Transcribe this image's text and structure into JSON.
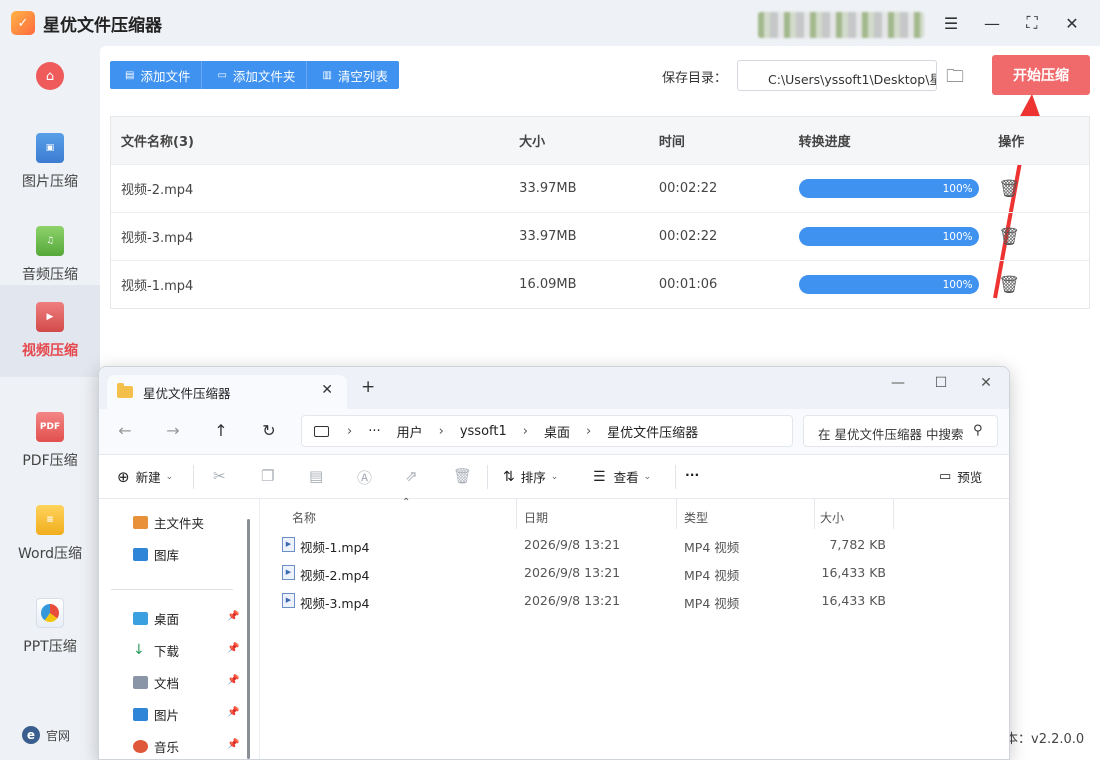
{
  "app": {
    "title": "星优文件压缩器",
    "version": "本：v2.2.0.0"
  },
  "titlebar": {
    "icons": [
      "settings-icon",
      "minimize-icon",
      "maximize-icon",
      "close-icon"
    ]
  },
  "sidebar": {
    "items": [
      {
        "label": "图片压缩",
        "icon": "image-icon"
      },
      {
        "label": "音频压缩",
        "icon": "audio-icon"
      },
      {
        "label": "视频压缩",
        "icon": "video-icon",
        "active": true
      },
      {
        "label": "PDF压缩",
        "icon": "pdf-icon",
        "badge": "PDF"
      },
      {
        "label": "Word压缩",
        "icon": "word-icon"
      },
      {
        "label": "PPT压缩",
        "icon": "ppt-icon"
      }
    ],
    "website": "官网"
  },
  "toolbar": {
    "add_file": "添加文件",
    "add_folder": "添加文件夹",
    "clear_list": "清空列表"
  },
  "save": {
    "label": "保存目录：",
    "path": "C:\\Users\\yssoft1\\Desktop\\星"
  },
  "start_button": "开始压缩",
  "table": {
    "headers": {
      "name": "文件名称(3)",
      "size": "大小",
      "time": "时间",
      "progress": "转换进度",
      "op": "操作"
    },
    "rows": [
      {
        "name": "视频-2.mp4",
        "size": "33.97MB",
        "time": "00:02:22",
        "progress": "100%"
      },
      {
        "name": "视频-3.mp4",
        "size": "33.97MB",
        "time": "00:02:22",
        "progress": "100%"
      },
      {
        "name": "视频-1.mp4",
        "size": "16.09MB",
        "time": "00:01:06",
        "progress": "100%"
      }
    ]
  },
  "explorer": {
    "tab_title": "星优文件压缩器",
    "breadcrumb": [
      "用户",
      "yssoft1",
      "桌面",
      "星优文件压缩器"
    ],
    "search_placeholder": "在 星优文件压缩器 中搜索",
    "commands": {
      "new": "新建",
      "sort": "排序",
      "view": "查看",
      "more": "···",
      "preview": "预览"
    },
    "left_nav": [
      {
        "label": "主文件夹",
        "pinned": false
      },
      {
        "label": "图库",
        "pinned": false
      },
      {
        "label": "桌面",
        "pinned": true
      },
      {
        "label": "下载",
        "pinned": true
      },
      {
        "label": "文档",
        "pinned": true
      },
      {
        "label": "图片",
        "pinned": true
      },
      {
        "label": "音乐",
        "pinned": true
      }
    ],
    "columns": {
      "name": "名称",
      "date": "日期",
      "type": "类型",
      "size": "大小"
    },
    "files": [
      {
        "name": "视频-1.mp4",
        "date": "2026/9/8 13:21",
        "type": "MP4 视频",
        "size": "7,782 KB"
      },
      {
        "name": "视频-2.mp4",
        "date": "2026/9/8 13:21",
        "type": "MP4 视频",
        "size": "16,433 KB"
      },
      {
        "name": "视频-3.mp4",
        "date": "2026/9/8 13:21",
        "type": "MP4 视频",
        "size": "16,433 KB"
      }
    ]
  }
}
